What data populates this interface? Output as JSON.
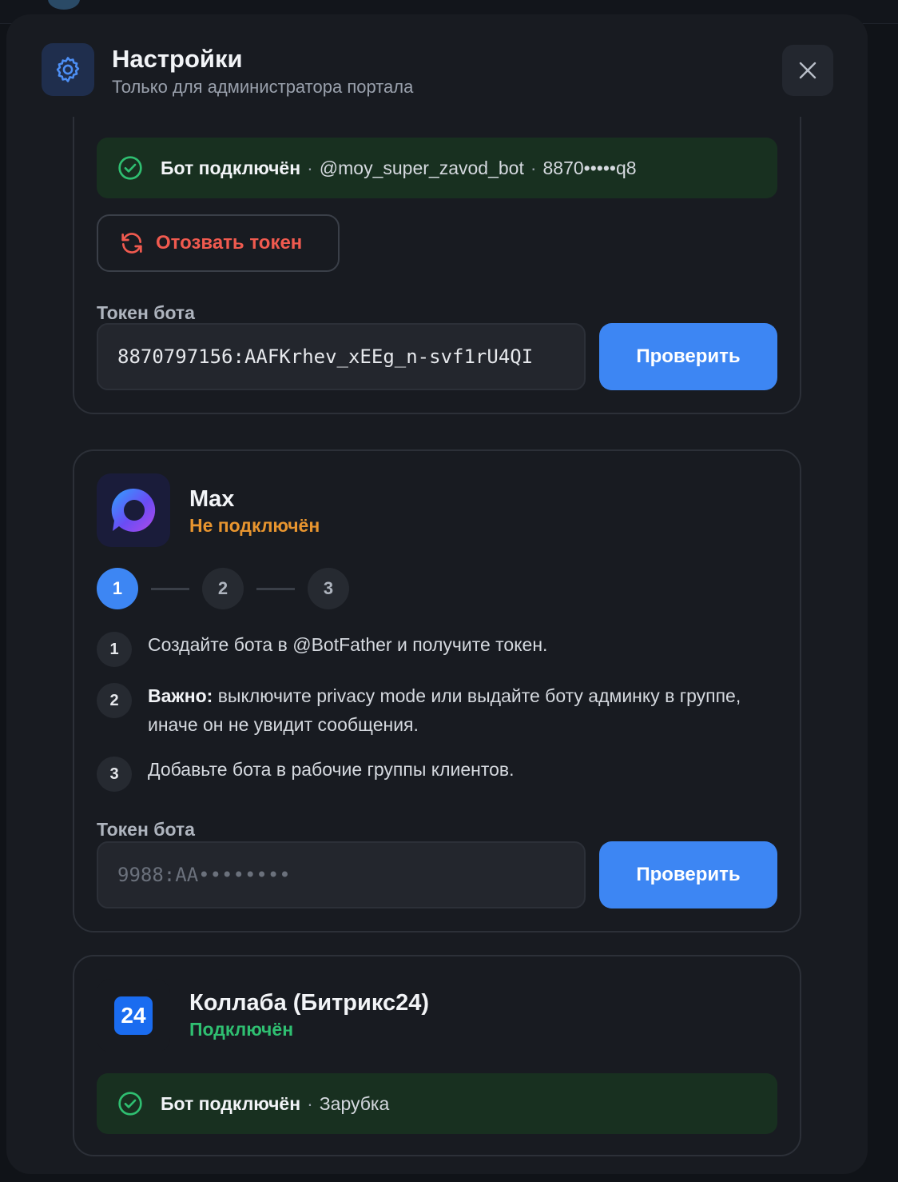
{
  "header": {
    "title": "Настройки",
    "subtitle": "Только для администратора портала",
    "icon": "gear-icon",
    "close_icon": "close-icon"
  },
  "telegram": {
    "banner_status": "Бот подключён",
    "banner_sep1": "·",
    "banner_username": "@moy_super_zavod_bot",
    "banner_sep2": "·",
    "banner_token_mask": "8870•••••q8",
    "revoke_label": "Отозвать токен",
    "token_label": "Токен бота",
    "token_value": "8870797156:AAFKrhev_xEEg_n-svf1rU4QI",
    "check_label": "Проверить"
  },
  "max": {
    "name": "Max",
    "status": "Не подключён",
    "status_color": "#e8952f",
    "stepper": [
      "1",
      "2",
      "3"
    ],
    "instructions": [
      {
        "num": "1",
        "text": "Создайте бота в @BotFather и получите токен."
      },
      {
        "num": "2",
        "bold": "Важно:",
        "text": " выключите privacy mode или выдайте боту админку в группе, иначе он не увидит сообщения."
      },
      {
        "num": "3",
        "text": "Добавьте бота в рабочие группы клиентов."
      }
    ],
    "token_label": "Токен бота",
    "token_placeholder": "9988:AA••••••••",
    "check_label": "Проверить"
  },
  "kollaba": {
    "name": "Коллаба (Битрикс24)",
    "logo_text": "24",
    "status": "Подключён",
    "status_color": "#2fbf71",
    "banner_status": "Бот подключён",
    "banner_sep": "·",
    "banner_value": "Зарубка"
  },
  "colors": {
    "accent": "#3d86f3",
    "success": "#2fbf71",
    "danger": "#f05a4f",
    "warning": "#e8952f"
  }
}
